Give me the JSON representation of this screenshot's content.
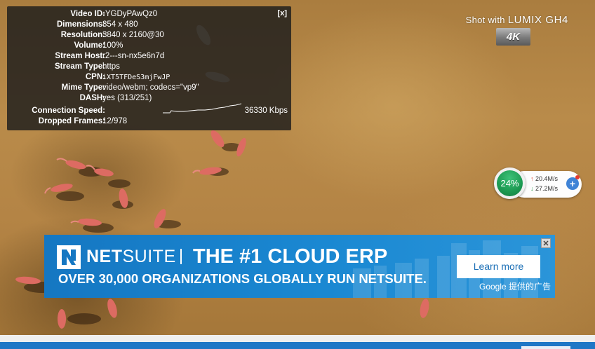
{
  "stats": {
    "close_label": "[x]",
    "rows": [
      {
        "label": "Video ID:",
        "value": "-YGDyPAwQz0"
      },
      {
        "label": "Dimensions:",
        "value": "854 x 480"
      },
      {
        "label": "Resolution:",
        "value": "3840 x 2160@30"
      },
      {
        "label": "Volume:",
        "value": "100%"
      },
      {
        "label": "Stream Host:",
        "value": "r2---sn-nx5e6n7d"
      },
      {
        "label": "Stream Type:",
        "value": "https"
      },
      {
        "label": "CPN:",
        "value": "iXT5TFDeS3mjFwJP"
      },
      {
        "label": "Mime Type:",
        "value": "video/webm; codecs=\"vp9\""
      },
      {
        "label": "DASH:",
        "value": "yes (313/251)"
      }
    ],
    "connection_label": "Connection Speed:",
    "connection_value": "36330 Kbps",
    "dropped_label": "Dropped Frames:",
    "dropped_value": "12/978"
  },
  "watermark": {
    "shot_with": "Shot with",
    "brand": "LUMIX GH4",
    "badge": "4K"
  },
  "net_widget": {
    "percent": "24%",
    "upload": "20.4M/s",
    "download": "27.2M/s",
    "up_icon": "↑",
    "down_icon": "↓",
    "plus": "+"
  },
  "ad": {
    "brand_bold": "NET",
    "brand_rest": "SUITE",
    "headline": "THE #1 CLOUD ERP",
    "subline": "OVER 30,000 ORGANIZATIONS GLOBALLY RUN NETSUITE.",
    "cta": "Learn more",
    "attribution": "Google 提供的广告",
    "close": "✕",
    "colors": {
      "background": "#1a88d2",
      "cta_text": "#1b6fb6"
    }
  }
}
